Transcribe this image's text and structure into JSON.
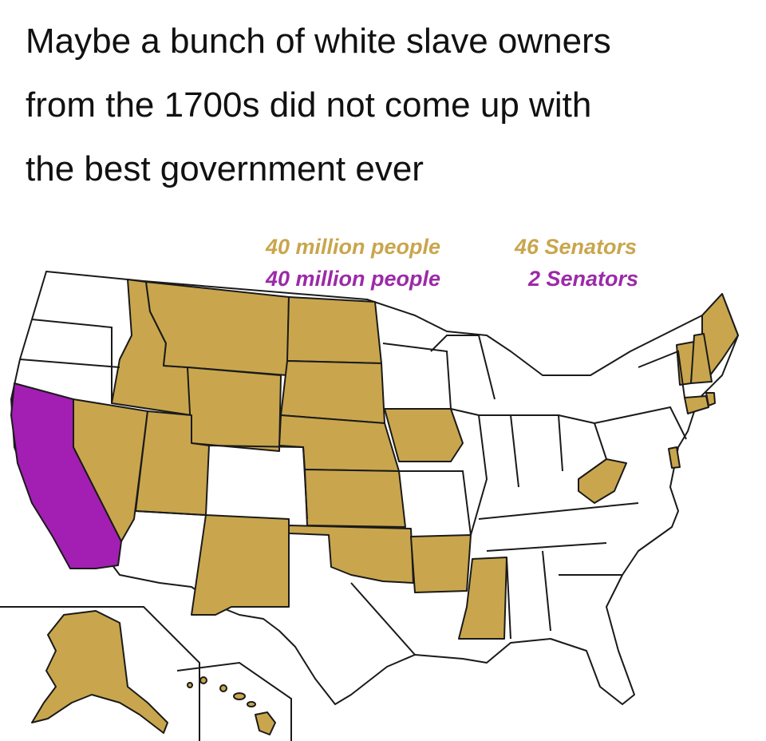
{
  "caption": {
    "line1": "Maybe a bunch of white slave owners",
    "line2": "from the 1700s did not come up with",
    "line3": "the best government ever"
  },
  "legend": {
    "gold_people": "40 million people",
    "gold_senators": "46 Senators",
    "purple_people": "40 million people",
    "purple_senators": "2 Senators"
  },
  "colors": {
    "gold": "#c9a64d",
    "purple": "#a31fb3",
    "white": "#ffffff",
    "border": "#1a1a1a"
  },
  "states": {
    "gold": [
      "Idaho",
      "Montana",
      "Wyoming",
      "North Dakota",
      "South Dakota",
      "Nebraska",
      "Kansas",
      "Oklahoma",
      "Nevada",
      "Utah",
      "New Mexico",
      "Iowa",
      "Arkansas",
      "Mississippi",
      "West Virginia",
      "Alaska",
      "Hawaii",
      "Maine",
      "Vermont",
      "New Hampshire",
      "Connecticut",
      "Rhode Island",
      "Delaware"
    ],
    "purple": [
      "California"
    ]
  }
}
